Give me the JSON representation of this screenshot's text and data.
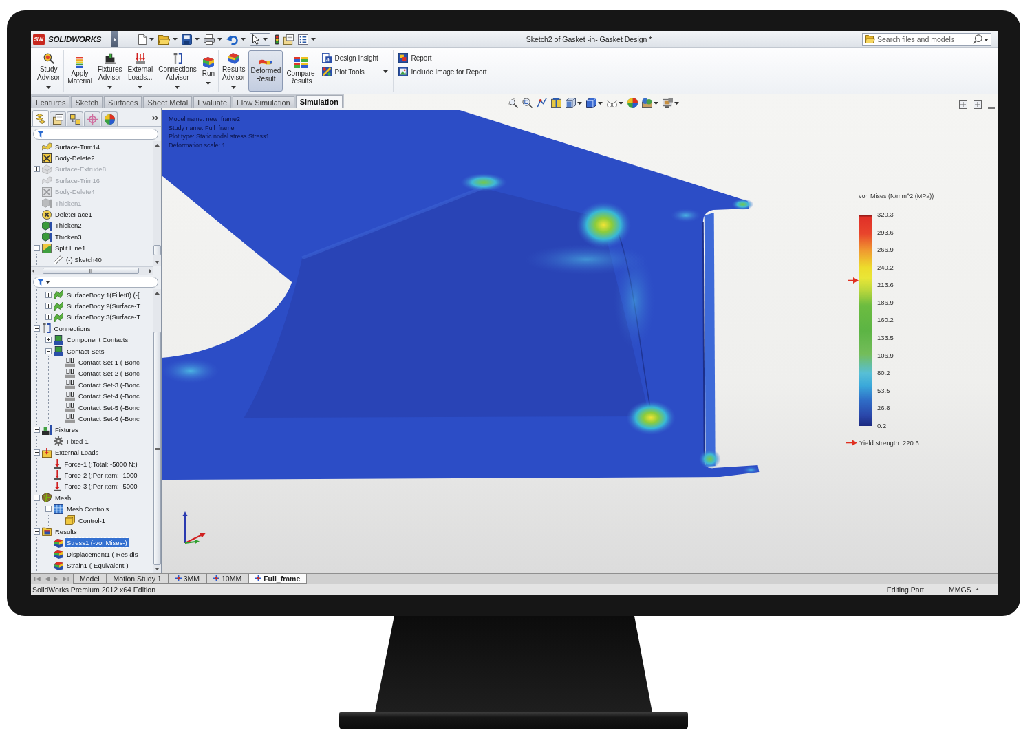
{
  "title_bar": {
    "logo_mark": "SW",
    "app_name": "SOLIDWORKS",
    "document_title": "Sketch2 of Gasket -in- Gasket Design *",
    "search": {
      "placeholder": "Search files and models"
    }
  },
  "ribbon": {
    "groups": [
      {
        "buttons": [
          {
            "label": "Study Advisor",
            "kind": "advisor",
            "dropdown": true,
            "on": false
          }
        ]
      },
      {
        "buttons": [
          {
            "label": "Apply Material",
            "kind": "material",
            "dropdown": false,
            "on": false
          },
          {
            "label": "Fixtures Advisor",
            "kind": "fixtures",
            "dropdown": true,
            "on": false
          },
          {
            "label": "External Loads...",
            "kind": "loads",
            "dropdown": true,
            "on": false
          },
          {
            "label": "Connections Advisor",
            "kind": "connections",
            "dropdown": true,
            "on": false
          },
          {
            "label": "Run",
            "kind": "run",
            "dropdown": true,
            "on": false
          }
        ]
      },
      {
        "buttons": [
          {
            "label": "Results Advisor",
            "kind": "results",
            "dropdown": true,
            "on": false
          },
          {
            "label": "Deformed Result",
            "kind": "deformed",
            "dropdown": false,
            "on": true
          },
          {
            "label": "Compare Results",
            "kind": "compare",
            "dropdown": false,
            "on": false
          }
        ],
        "stack": [
          {
            "label": "Design Insight",
            "kind": "insight",
            "dropdown": false
          },
          {
            "label": "Plot Tools",
            "kind": "plottools",
            "dropdown": true
          }
        ]
      },
      {
        "stack": [
          {
            "label": "Report",
            "kind": "report",
            "dropdown": false
          },
          {
            "label": "Include Image for Report",
            "kind": "image",
            "dropdown": false
          }
        ]
      }
    ]
  },
  "tabs": [
    {
      "label": "Features",
      "selected": false
    },
    {
      "label": "Sketch",
      "selected": false
    },
    {
      "label": "Surfaces",
      "selected": false
    },
    {
      "label": "Sheet Metal",
      "selected": false
    },
    {
      "label": "Evaluate",
      "selected": false
    },
    {
      "label": "Flow Simulation",
      "selected": false
    },
    {
      "label": "Simulation",
      "selected": true
    }
  ],
  "left_panel": {
    "panel_tabs": [
      {
        "kind": "feature",
        "selected": true
      },
      {
        "kind": "property",
        "selected": false
      },
      {
        "kind": "configuration",
        "selected": false
      },
      {
        "kind": "dimxpert",
        "selected": false
      },
      {
        "kind": "display",
        "selected": false
      }
    ],
    "feature_tree": [
      {
        "label": "Surface-Trim14",
        "kind": "surface",
        "suppressed": false,
        "selected": false
      },
      {
        "label": "Body-Delete2",
        "kind": "deletebody",
        "suppressed": false,
        "selected": false
      },
      {
        "label": "Surface-Extrude8",
        "kind": "extrude",
        "suppressed": true,
        "selected": false,
        "expanded": false
      },
      {
        "label": "Surface-Trim16",
        "kind": "surface",
        "suppressed": true,
        "selected": false
      },
      {
        "label": "Body-Delete4",
        "kind": "deletebody",
        "suppressed": true,
        "selected": false
      },
      {
        "label": "Thicken1",
        "kind": "thicken",
        "suppressed": true,
        "selected": false
      },
      {
        "label": "DeleteFace1",
        "kind": "deleteface",
        "suppressed": false,
        "selected": false
      },
      {
        "label": "Thicken2",
        "kind": "thicken",
        "suppressed": false,
        "selected": false
      },
      {
        "label": "Thicken3",
        "kind": "thicken",
        "suppressed": false,
        "selected": false
      },
      {
        "label": "Split Line1",
        "kind": "splitline",
        "suppressed": false,
        "selected": false,
        "expanded": true,
        "children": [
          {
            "label": "(-) Sketch40",
            "kind": "sketch",
            "suppressed": false,
            "selected": false
          }
        ]
      }
    ],
    "study_tree": [
      {
        "children": [
          {
            "label": "SurfaceBody 1(Fillet8) (-[",
            "kind": "body",
            "selected": false,
            "expanded": false
          },
          {
            "label": "SurfaceBody 2(Surface-T",
            "kind": "body",
            "selected": false,
            "expanded": false
          },
          {
            "label": "SurfaceBody 3(Surface-T",
            "kind": "body",
            "selected": false,
            "expanded": false
          }
        ]
      },
      {
        "label": "Connections",
        "kind": "connections",
        "selected": false,
        "expanded": true,
        "children": [
          {
            "label": "Component Contacts",
            "kind": "contacts",
            "selected": false,
            "expanded": false
          },
          {
            "label": "Contact Sets",
            "kind": "contacts",
            "selected": false,
            "expanded": true,
            "children": [
              {
                "label": "Contact Set-1 (-Bonc",
                "kind": "contactset",
                "selected": false
              },
              {
                "label": "Contact Set-2 (-Bonc",
                "kind": "contactset",
                "selected": false
              },
              {
                "label": "Contact Set-3 (-Bonc",
                "kind": "contactset",
                "selected": false
              },
              {
                "label": "Contact Set-4 (-Bonc",
                "kind": "contactset",
                "selected": false
              },
              {
                "label": "Contact Set-5 (-Bonc",
                "kind": "contactset",
                "selected": false
              },
              {
                "label": "Contact Set-6 (-Bonc",
                "kind": "contactset",
                "selected": false
              }
            ]
          }
        ]
      },
      {
        "label": "Fixtures",
        "kind": "fixtures",
        "selected": false,
        "expanded": true,
        "children": [
          {
            "label": "Fixed-1",
            "kind": "fixed",
            "selected": false
          }
        ]
      },
      {
        "label": "External Loads",
        "kind": "loads",
        "selected": false,
        "expanded": true,
        "children": [
          {
            "label": "Force-1 (:Total: -5000 N:)",
            "kind": "force",
            "selected": false
          },
          {
            "label": "Force-2 (:Per item: -1000",
            "kind": "force",
            "selected": false
          },
          {
            "label": "Force-3 (:Per item: -5000",
            "kind": "force",
            "selected": false
          }
        ]
      },
      {
        "label": "Mesh",
        "kind": "mesh",
        "selected": false,
        "expanded": true,
        "children": [
          {
            "label": "Mesh Controls",
            "kind": "meshcontrol",
            "selected": false,
            "expanded": true,
            "children": [
              {
                "label": "Control-1",
                "kind": "control",
                "selected": false
              }
            ]
          }
        ]
      },
      {
        "label": "Results",
        "kind": "results",
        "selected": false,
        "expanded": true,
        "children": [
          {
            "label": "Stress1 (-vonMises-)",
            "kind": "plot",
            "selected": true
          },
          {
            "label": "Displacement1 (-Res dis",
            "kind": "plot",
            "selected": false
          },
          {
            "label": "Strain1 (-Equivalent-)",
            "kind": "plot",
            "selected": false
          }
        ]
      }
    ]
  },
  "viewport": {
    "plot_info": [
      "Model name: new_frame2",
      "Study name: Full_frame",
      "Plot type: Static nodal stress Stress1",
      "Deformation scale: 1"
    ],
    "legend": {
      "title": "von Mises (N/mm^2 (MPa))",
      "ticks": [
        "320.3",
        "293.6",
        "266.9",
        "240.2",
        "213.6",
        "186.9",
        "160.2",
        "133.5",
        "106.9",
        "80.2",
        "53.5",
        "26.8",
        "0.2"
      ],
      "yield_marker": {
        "level": 0.69,
        "label": "Yield strength: 220.6"
      }
    }
  },
  "bottom_tabs": [
    {
      "label": "Model",
      "kind": "plain",
      "selected": false
    },
    {
      "label": "Motion Study 1",
      "kind": "plain",
      "selected": false
    },
    {
      "label": "3MM",
      "kind": "study",
      "selected": false
    },
    {
      "label": "10MM",
      "kind": "study",
      "selected": false
    },
    {
      "label": "Full_frame",
      "kind": "study",
      "selected": true
    }
  ],
  "status_bar": {
    "product": "SolidWorks Premium 2012 x64 Edition",
    "mode": "Editing Part",
    "units": "MMGS"
  }
}
